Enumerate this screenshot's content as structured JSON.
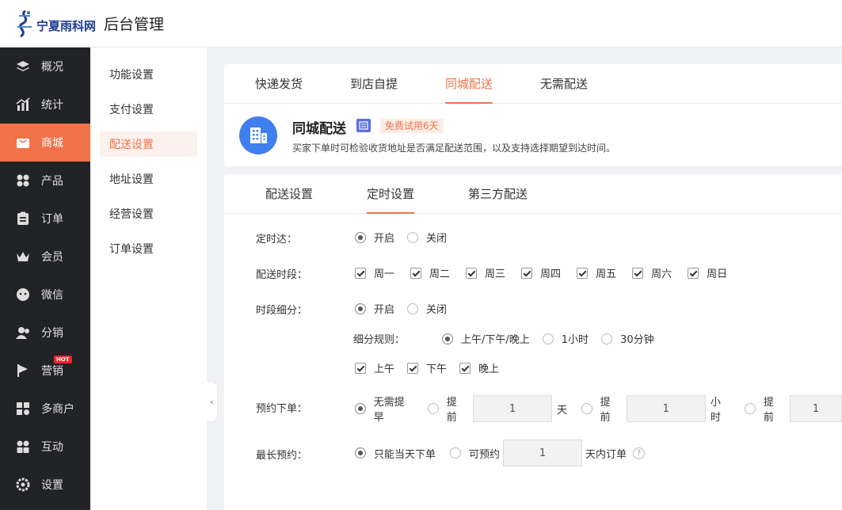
{
  "header": {
    "brand": "宁夏雨科网",
    "title": "后台管理"
  },
  "sidebar": {
    "items": [
      {
        "label": "概况",
        "icon": "layers-icon"
      },
      {
        "label": "统计",
        "icon": "chart-icon"
      },
      {
        "label": "商城",
        "icon": "shop-icon"
      },
      {
        "label": "产品",
        "icon": "grid-icon"
      },
      {
        "label": "订单",
        "icon": "clipboard-icon"
      },
      {
        "label": "会员",
        "icon": "crown-icon"
      },
      {
        "label": "微信",
        "icon": "wechat-icon"
      },
      {
        "label": "分销",
        "icon": "users-icon"
      },
      {
        "label": "营销",
        "icon": "flag-icon",
        "badge": "HOT"
      },
      {
        "label": "多商户",
        "icon": "store-icon"
      },
      {
        "label": "互动",
        "icon": "interact-icon"
      },
      {
        "label": "设置",
        "icon": "gear-icon"
      }
    ]
  },
  "subnav": {
    "items": [
      "功能设置",
      "支付设置",
      "配送设置",
      "地址设置",
      "经营设置",
      "订单设置"
    ]
  },
  "delivery_tabs": [
    "快递发货",
    "到店自提",
    "同城配送",
    "无需配送"
  ],
  "info": {
    "title": "同城配送",
    "badge_icon": "receipt-icon",
    "trial": "免费试用6天",
    "desc": "买家下单时可检验收货地址是否满足配送范围，以及支持选择期望到达时间。"
  },
  "settings_tabs": [
    "配送设置",
    "定时设置",
    "第三方配送"
  ],
  "form": {
    "timed": {
      "label": "定时达：",
      "on": "开启",
      "off": "关闭"
    },
    "period": {
      "label": "配送时段：",
      "days": [
        "周一",
        "周二",
        "周三",
        "周四",
        "周五",
        "周六",
        "周日"
      ]
    },
    "subdivide": {
      "label": "时段细分：",
      "on": "开启",
      "off": "关闭"
    },
    "rule": {
      "label": "细分规则：",
      "options": [
        "上午/下午/晚上",
        "1小时",
        "30分钟"
      ]
    },
    "slots": [
      "上午",
      "下午",
      "晚上"
    ],
    "advance": {
      "label": "预约下单：",
      "none": "无需提早",
      "ahead": "提前",
      "day_value": "1",
      "day_unit": "天",
      "hour_value": "1",
      "hour_unit": "小时",
      "min_value": "1"
    },
    "longest": {
      "label": "最长预约：",
      "same_day": "只能当天下单",
      "can": "可预约",
      "value": "1",
      "suffix": "天内订单",
      "help": "?"
    }
  },
  "colors": {
    "accent": "#f0734a",
    "sidebar": "#222326",
    "info_icon": "#3f7ff0"
  }
}
